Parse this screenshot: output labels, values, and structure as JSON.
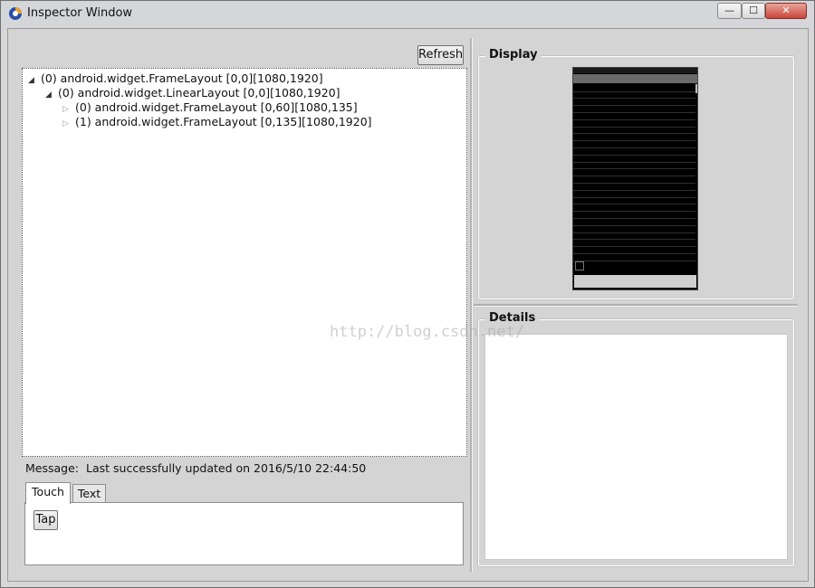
{
  "window": {
    "title": "Inspector Window",
    "controls": {
      "minimize": "—",
      "maximize": "☐",
      "close": "✕"
    }
  },
  "toolbar": {
    "refresh_label": "Refresh"
  },
  "tree": {
    "nodes": [
      {
        "label": "(0) android.widget.FrameLayout [0,0][1080,1920]",
        "expanded": true
      },
      {
        "label": "(0) android.widget.LinearLayout [0,0][1080,1920]",
        "expanded": true
      },
      {
        "label": "(0) android.widget.FrameLayout [0,60][1080,135]",
        "expanded": false
      },
      {
        "label": "(1) android.widget.FrameLayout [0,135][1080,1920]",
        "expanded": false
      }
    ]
  },
  "message": {
    "label": "Message:",
    "text": "Last successfully updated on 2016/5/10 22:44:50"
  },
  "tabs": [
    {
      "label": "Touch",
      "active": true
    },
    {
      "label": "Text",
      "active": false
    }
  ],
  "touch_panel": {
    "tap_label": "Tap"
  },
  "display": {
    "title": "Display",
    "phone": {
      "title_bar": "",
      "list_items": [
        "",
        "",
        "",
        "",
        "",
        "",
        "",
        "",
        "",
        "",
        "",
        "",
        "",
        "",
        "",
        "",
        "",
        "",
        "",
        "",
        "",
        "",
        "",
        "",
        ""
      ],
      "checkbox_label": "",
      "button_label": ""
    }
  },
  "details": {
    "title": "Details"
  },
  "watermark": "http://blog.csdn.net/",
  "colors": {
    "background": "#d4d4d4",
    "phone_screen": "#000000"
  }
}
